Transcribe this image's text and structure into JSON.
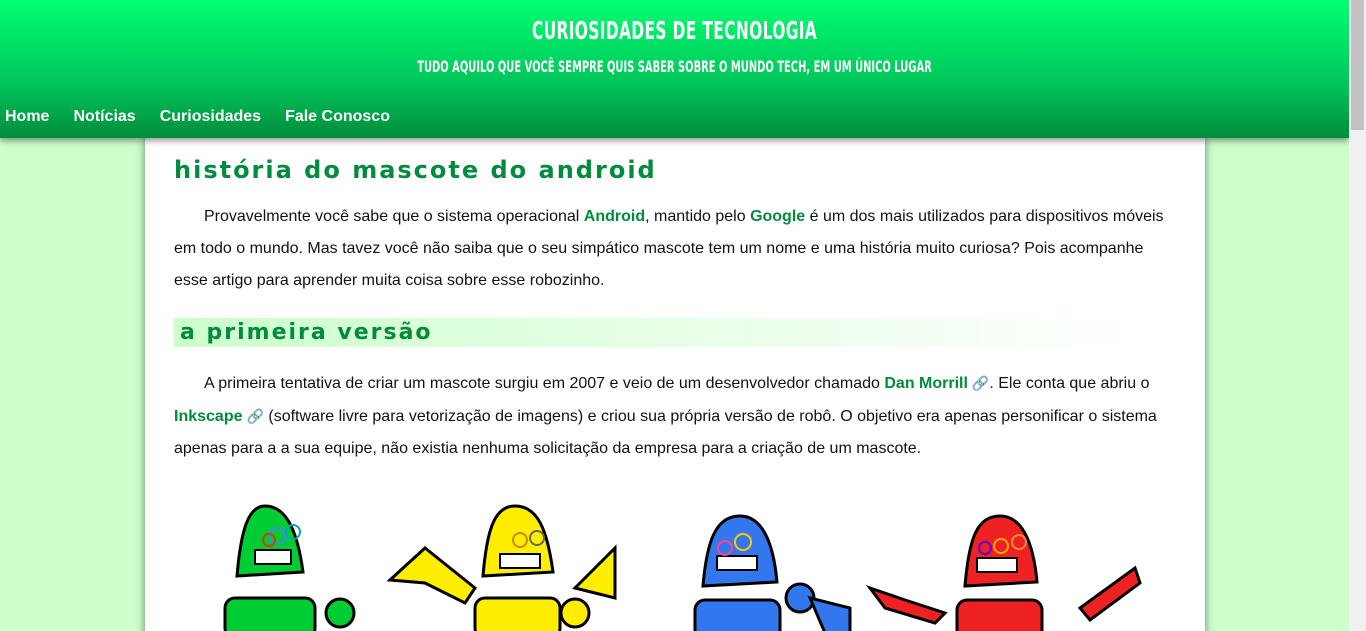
{
  "site": {
    "title": "CURIOSIDADES DE TECNOLOGIA",
    "subtitle": "TUDO AQUILO QUE VOCÊ SEMPRE QUIS SABER SOBRE O MUNDO TECH, EM UM ÚNICO LUGAR"
  },
  "nav": [
    "Home",
    "Notícias",
    "Curiosidades",
    "Fale Conosco"
  ],
  "article": {
    "title": "História do Mascote do Android",
    "intro": {
      "t1": "Provavelmente você sabe que o sistema operacional ",
      "link1": "Android",
      "t2": ", mantido pelo ",
      "link2": "Google",
      "t3": " é um dos mais utilizados para dispositivos móveis em todo o mundo. Mas tavez você não saiba que o seu simpático mascote tem um nome e uma história muito curiosa? Pois acompanhe esse artigo para aprender muita coisa sobre esse robozinho."
    },
    "section1": {
      "title": "A Primeira Versão",
      "t1": "A primeira tentativa de criar um mascote surgiu em 2007 e veio de um desenvolvedor chamado ",
      "link1": "Dan Morrill",
      "t2": ". Ele conta que abriu o ",
      "link2": "Inkscape",
      "t3": " (software livre para vetorização de imagens) e criou sua própria versão de robô. O objetivo era apenas personificar o sistema apenas para a a sua equipe, não existia nenhuma solicitação da empresa para a criação de um mascote."
    }
  },
  "colors": {
    "accent": "#008c3c",
    "header_top": "#00ff73",
    "page_bg": "#ccffcc",
    "robot_colors": [
      "#00cc33",
      "#ffee00",
      "#3377ee",
      "#ee2222"
    ]
  },
  "icons": {
    "external_link": "link-icon"
  }
}
